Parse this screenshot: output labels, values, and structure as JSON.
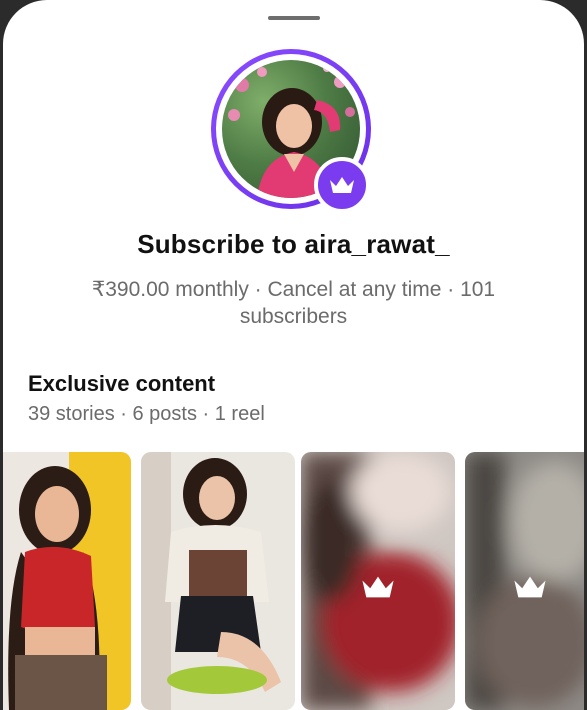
{
  "sheet": {
    "handle_icon": "drag-handle"
  },
  "profile": {
    "username": "aira_rawat_",
    "avatar_icon": "profile-photo",
    "badge_icon": "crown-icon",
    "ring_color": "#7b3cf0"
  },
  "subscribe": {
    "title": "Subscribe to aira_rawat_",
    "meta": "₹390.00 monthly · Cancel at any time · 101 subscribers"
  },
  "exclusive": {
    "title": "Exclusive content",
    "summary": "39 stories · 6 posts · 1 reel"
  },
  "thumbnails": [
    {
      "kind": "preview-photo",
      "locked": false
    },
    {
      "kind": "preview-photo",
      "locked": false
    },
    {
      "kind": "blurred-photo",
      "locked": true,
      "lock_icon": "crown-icon"
    },
    {
      "kind": "blurred-photo",
      "locked": true,
      "lock_icon": "crown-icon"
    }
  ]
}
